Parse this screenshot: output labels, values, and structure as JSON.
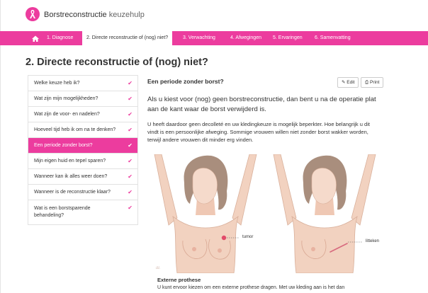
{
  "header": {
    "brand_bold": "Borstreconstructie",
    "brand_rest": "keuzehulp",
    "logo_icon": "pink-ribbon-icon"
  },
  "nav": {
    "home_icon": "home-icon",
    "items": [
      {
        "label": "1. Diagnose",
        "active": false
      },
      {
        "label": "2. Directe reconstructie of (nog) niet?",
        "active": true
      },
      {
        "label": "3. Verwachting",
        "active": false
      },
      {
        "label": "4. Afwegingen",
        "active": false
      },
      {
        "label": "5. Ervaringen",
        "active": false
      },
      {
        "label": "6. Samenvatting",
        "active": false
      }
    ]
  },
  "page": {
    "title": "2. Directe reconstructie of (nog) niet?"
  },
  "sidebar": {
    "items": [
      {
        "label": "Welke keuze heb ik?",
        "checked": true
      },
      {
        "label": "Wat zijn mijn mogelijkheden?",
        "checked": true
      },
      {
        "label": "Wat zijn de voor- en nadelen?",
        "checked": true
      },
      {
        "label": "Hoeveel tijd heb ik om na te denken?",
        "checked": true
      },
      {
        "label": "Een periode zonder borst?",
        "checked": true,
        "active": true
      },
      {
        "label": "Mijn eigen huid en tepel sparen?",
        "checked": true
      },
      {
        "label": "Wanneer kan ik alles weer doen?",
        "checked": true
      },
      {
        "label": "Wanneer is de reconstructie klaar?",
        "checked": true
      },
      {
        "label": "Wat is een borstsparende behandeling?",
        "checked": true
      }
    ]
  },
  "content": {
    "title": "Een periode zonder borst?",
    "edit_label": "Edit",
    "print_label": "Print",
    "edit_icon": "pencil-icon",
    "print_icon": "printer-icon",
    "lead": "Als u kiest voor (nog) geen borstreconstructie, dan bent u na de operatie plat aan de kant waar de borst verwijderd is.",
    "paragraph": "U heeft daardoor geen decolleté en uw kledingkeuze is mogelijk beperkter. Hoe belangrijk u dit vindt is een persoonlijke afweging. Sommige vrouwen willen niet zonder borst wakker worden, terwijl andere vrouwen dit minder erg vinden.",
    "illustration_left_label": "tumor",
    "illustration_right_label": "litteken",
    "subsection_title": "Externe prothese",
    "subsection_text": "U kunt ervoor kiezen om een externe prothese dragen. Met uw kleding aan is het dan"
  },
  "colors": {
    "accent": "#ec3c9e",
    "skin": "#f2d2c0",
    "hair": "#a98e7d"
  }
}
